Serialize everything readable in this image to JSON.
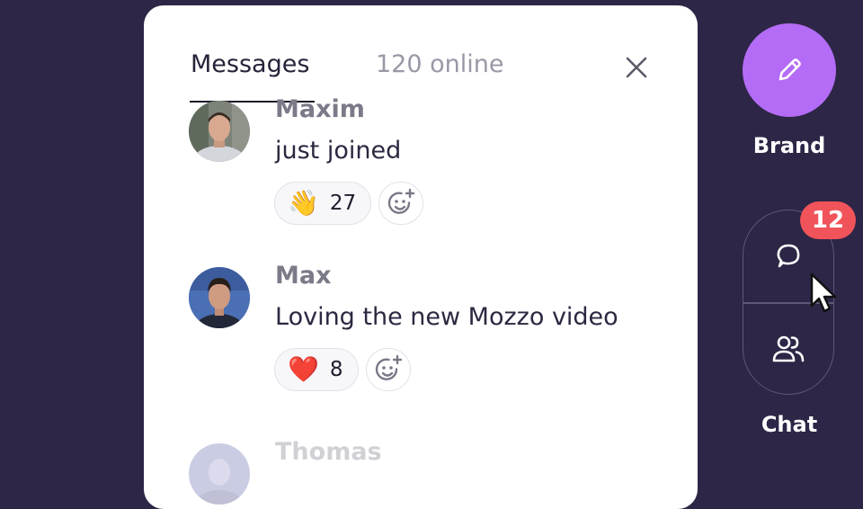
{
  "panel": {
    "tabs": {
      "messages": "Messages",
      "online": "120 online"
    }
  },
  "messages": [
    {
      "name": "Maxim",
      "text": "just joined",
      "reaction": {
        "emoji": "👋",
        "count": "27"
      }
    },
    {
      "name": "Max",
      "text": "Loving the new Mozzo video",
      "reaction": {
        "emoji": "❤️",
        "count": "8"
      }
    },
    {
      "name": "Thomas"
    }
  ],
  "rail": {
    "brand_label": "Brand",
    "chat_label": "Chat",
    "badge_count": "12"
  },
  "icons": {
    "close": "close-icon",
    "add_reaction": "add-reaction-icon",
    "brand": "pencil-icon",
    "chat": "chat-bubble-icon",
    "people": "people-icon",
    "cursor": "mouse-pointer-icon"
  },
  "colors": {
    "background": "#2d2646",
    "brand_accent": "#b46cf6",
    "badge": "#f0545a"
  }
}
